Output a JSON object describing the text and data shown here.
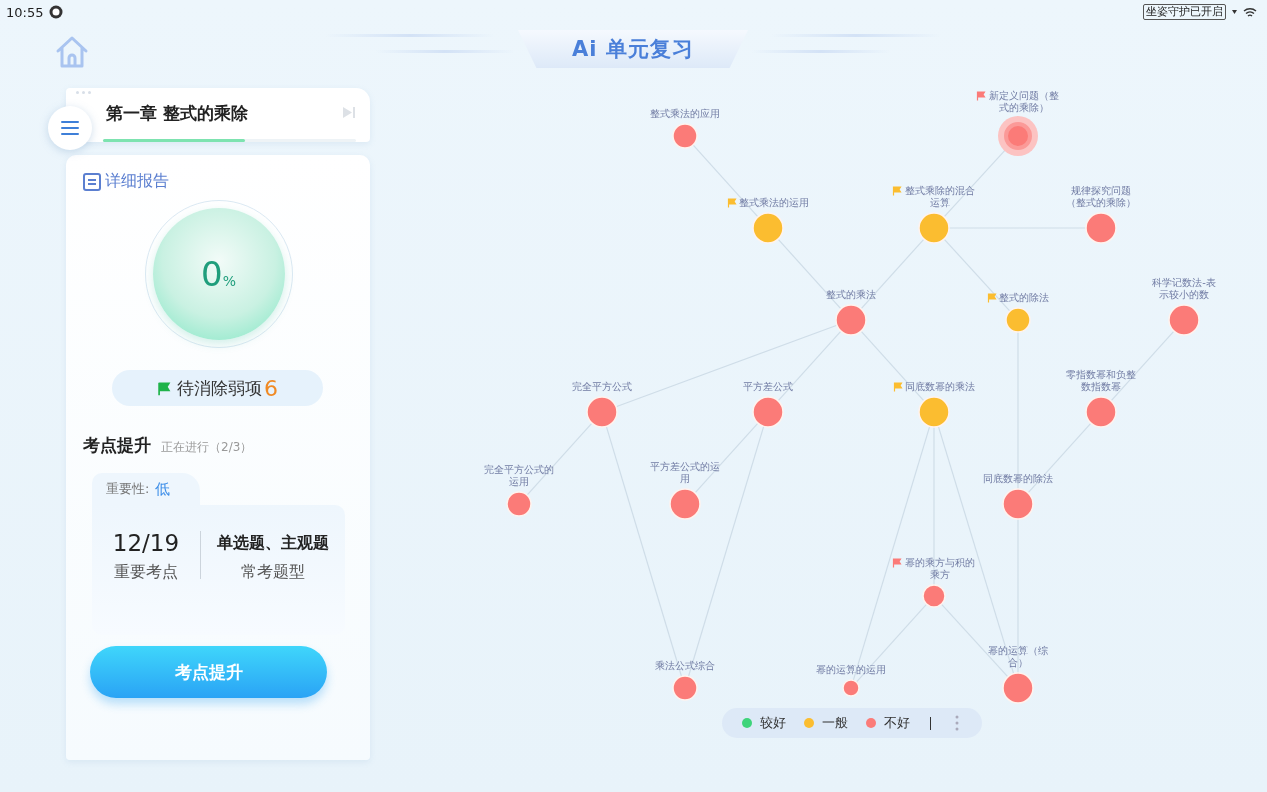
{
  "status_bar": {
    "time": "10:55",
    "notice": "坐姿守护已开启"
  },
  "header": {
    "title": "Ai 单元复习"
  },
  "chapter": {
    "title": "第一章 整式的乘除",
    "level": 0.56
  },
  "report": {
    "link": "详细报告",
    "gauge": {
      "value": "0",
      "unit": "%"
    },
    "weak": {
      "label": "待消除弱项",
      "count": "6"
    }
  },
  "boost": {
    "title": "考点提升",
    "status": "正在进行（2/3）",
    "importance_label": "重要性:",
    "importance": "低",
    "stats": [
      {
        "value": "12/19",
        "label": "重要考点"
      },
      {
        "value": "单选题、主观题",
        "label": "常考题型"
      }
    ],
    "button": "考点提升"
  },
  "graph": {
    "nodes": [
      {
        "label": "整式乘法的应用",
        "color": "#fb7b78",
        "flagged": false,
        "selected": false
      },
      {
        "label": "新定义问题（整式的乘除）",
        "color": "#fb7b78",
        "flagged": true,
        "selected": true
      },
      {
        "label": "整式乘法的运用",
        "color": "#fbbd30",
        "flagged": true,
        "selected": false
      },
      {
        "label": "整式乘除的混合运算",
        "color": "#fbbd30",
        "flagged": true,
        "selected": false
      },
      {
        "label": "规律探究问题（整式的乘除）",
        "color": "#fb7b78",
        "flagged": false,
        "selected": false
      },
      {
        "label": "整式的乘法",
        "color": "#fb7b78",
        "flagged": false,
        "selected": false
      },
      {
        "label": "整式的除法",
        "color": "#fbbd30",
        "flagged": true,
        "selected": false
      },
      {
        "label": "科学记数法-表示较小的数",
        "color": "#fb7b78",
        "flagged": false,
        "selected": false
      },
      {
        "label": "完全平方公式",
        "color": "#fb7b78",
        "flagged": false,
        "selected": false
      },
      {
        "label": "平方差公式",
        "color": "#fb7b78",
        "flagged": false,
        "selected": false
      },
      {
        "label": "同底数幂的乘法",
        "color": "#fbbd30",
        "flagged": true,
        "selected": false
      },
      {
        "label": "零指数幂和负整数指数幂",
        "color": "#fb7b78",
        "flagged": false,
        "selected": false
      },
      {
        "label": "完全平方公式的运用",
        "color": "#fb7b78",
        "flagged": false,
        "selected": false
      },
      {
        "label": "平方差公式的运用",
        "color": "#fb7b78",
        "flagged": false,
        "selected": false
      },
      {
        "label": "同底数幂的除法",
        "color": "#fb7b78",
        "flagged": false,
        "selected": false
      },
      {
        "label": "幂的乘方与积的乘方",
        "color": "#fb7b78",
        "flagged": true,
        "selected": false
      },
      {
        "label": "乘法公式综合",
        "color": "#fb7b78",
        "flagged": false,
        "selected": false
      },
      {
        "label": "幂的运算的运用",
        "color": "#fb7b78",
        "flagged": false,
        "selected": false
      },
      {
        "label": "幂的运算（综合）",
        "color": "#fb7b78",
        "flagged": false,
        "selected": false
      }
    ]
  },
  "legend": [
    {
      "label": "较好",
      "color": "#3ed47a"
    },
    {
      "label": "一般",
      "color": "#fbbd30"
    },
    {
      "label": "不好",
      "color": "#fb7b78"
    }
  ]
}
